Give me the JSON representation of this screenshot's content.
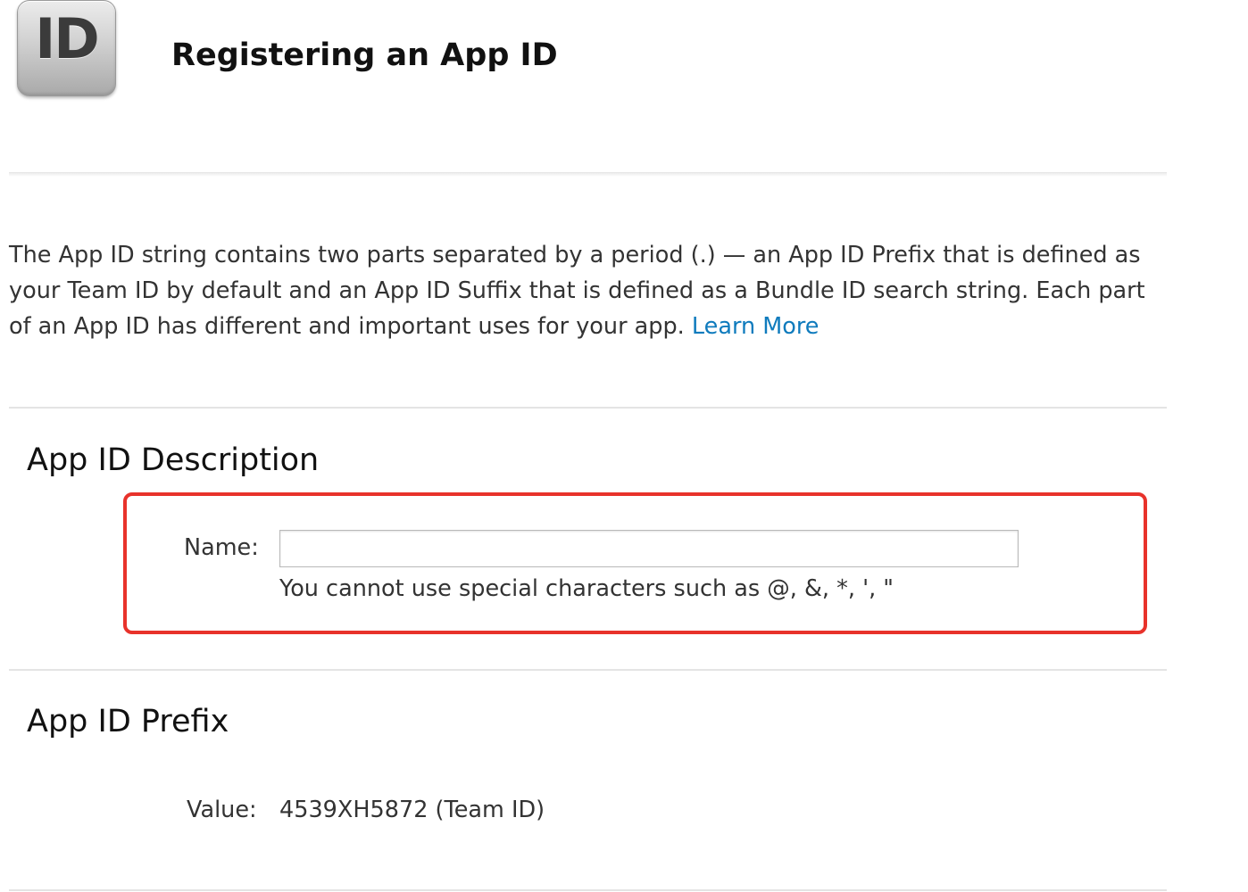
{
  "header": {
    "icon_text": "ID",
    "icon_name": "app-id-icon",
    "title": "Registering an App ID"
  },
  "intro": {
    "text": "The App ID string contains two parts separated by a period (.) — an App ID Prefix that is defined as your Team ID by default and an App ID Suffix that is defined as a Bundle ID search string. Each part of an App ID has different and important uses for your app. ",
    "link_label": "Learn More"
  },
  "description_section": {
    "heading": "App ID Description",
    "name_label": "Name:",
    "name_value": "",
    "name_placeholder": "",
    "hint": "You cannot use special characters such as @, &, *, ', \""
  },
  "prefix_section": {
    "heading": "App ID Prefix",
    "value_label": "Value:",
    "value": "4539XH5872 (Team ID)"
  },
  "colors": {
    "link": "#0f7bbd",
    "highlight": "#e8322b"
  }
}
